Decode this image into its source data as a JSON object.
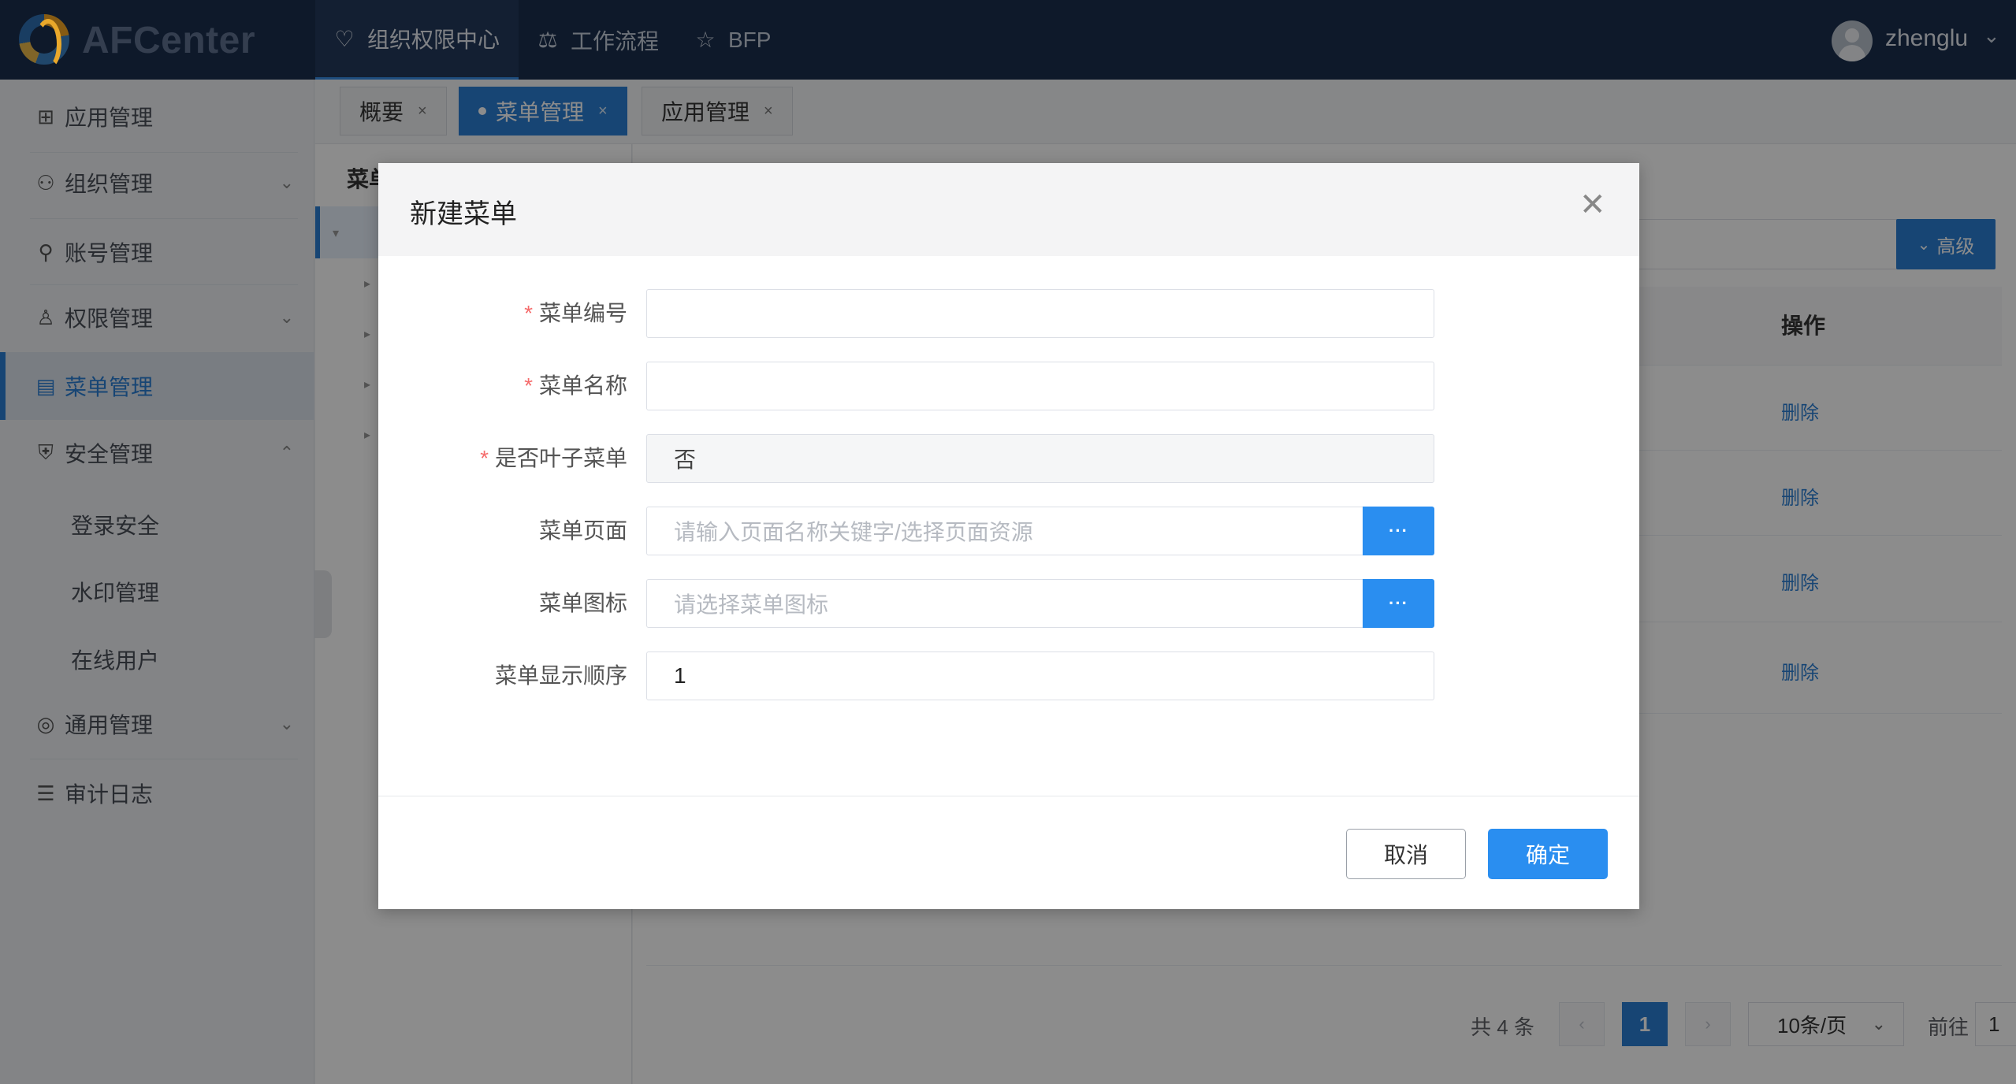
{
  "app": {
    "name": "AFCenter"
  },
  "topnav": [
    {
      "label": "组织权限中心",
      "icon": "shield-heart-icon"
    },
    {
      "label": "工作流程",
      "icon": "scale-icon"
    },
    {
      "label": "BFP",
      "icon": "star-icon"
    }
  ],
  "user": {
    "name": "zhenglu"
  },
  "sidebar": {
    "items": [
      {
        "label": "应用管理",
        "icon": "apps-grid-icon"
      },
      {
        "label": "组织管理",
        "icon": "team-icon"
      },
      {
        "label": "账号管理",
        "icon": "user-icon"
      },
      {
        "label": "权限管理",
        "icon": "permission-user-icon"
      },
      {
        "label": "菜单管理",
        "icon": "menu-doc-icon"
      },
      {
        "label": "安全管理",
        "icon": "shield-plus-icon"
      },
      {
        "label": "通用管理",
        "icon": "target-icon"
      },
      {
        "label": "审计日志",
        "icon": "log-doc-icon"
      }
    ],
    "security_sub": [
      "登录安全",
      "水印管理",
      "在线用户"
    ]
  },
  "tabs": [
    {
      "label": "概要"
    },
    {
      "label": "菜单管理"
    },
    {
      "label": "应用管理"
    }
  ],
  "tree": {
    "title_partial": "菜单"
  },
  "content": {
    "advanced_button": "高级",
    "column_operation": "操作",
    "delete_link": "删除",
    "rows_count": 4
  },
  "pagination": {
    "total": "共 4 条",
    "current_page": "1",
    "page_size": "10条/页",
    "goto_label": "前往",
    "goto_value": "1"
  },
  "dialog": {
    "title": "新建菜单",
    "fields": {
      "code": {
        "label": "菜单编号",
        "required": true,
        "value": ""
      },
      "name": {
        "label": "菜单名称",
        "required": true,
        "value": ""
      },
      "is_leaf": {
        "label": "是否叶子菜单",
        "required": true,
        "value": "否"
      },
      "page": {
        "label": "菜单页面",
        "placeholder": "请输入页面名称关键字/选择页面资源"
      },
      "icon": {
        "label": "菜单图标",
        "placeholder": "请选择菜单图标"
      },
      "order": {
        "label": "菜单显示顺序",
        "value": "1"
      }
    },
    "ellipsis": "···",
    "cancel": "取消",
    "confirm": "确定"
  },
  "colors": {
    "primary": "#2a7fd4",
    "button_blue": "#2a8ef0",
    "header_bg": "#1b2f4e",
    "required": "#f56c6c"
  }
}
